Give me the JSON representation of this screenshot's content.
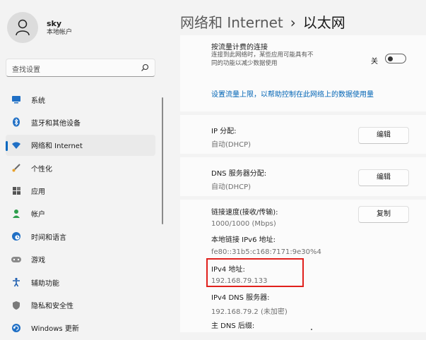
{
  "user": {
    "name": "sky",
    "account_type": "本地帐户"
  },
  "search": {
    "placeholder": "查找设置"
  },
  "sidebar": {
    "items": [
      {
        "label": "系统",
        "icon": "monitor-icon",
        "selected": false
      },
      {
        "label": "蓝牙和其他设备",
        "icon": "bluetooth-icon",
        "selected": false
      },
      {
        "label": "网络和 Internet",
        "icon": "wifi-icon",
        "selected": true
      },
      {
        "label": "个性化",
        "icon": "brush-icon",
        "selected": false
      },
      {
        "label": "应用",
        "icon": "apps-icon",
        "selected": false
      },
      {
        "label": "帐户",
        "icon": "person-icon",
        "selected": false
      },
      {
        "label": "时间和语言",
        "icon": "globe-clock-icon",
        "selected": false
      },
      {
        "label": "游戏",
        "icon": "gamepad-icon",
        "selected": false
      },
      {
        "label": "辅助功能",
        "icon": "accessibility-icon",
        "selected": false
      },
      {
        "label": "隐私和安全性",
        "icon": "shield-icon",
        "selected": false
      },
      {
        "label": "Windows 更新",
        "icon": "update-icon",
        "selected": false
      }
    ]
  },
  "header": {
    "parent": "网络和 Internet",
    "separator": "›",
    "current": "以太网"
  },
  "metered": {
    "title": "按流量计费的连接",
    "description": "连接到此网络时，某些应用可能具有不同的功能以减少数据使用",
    "toggle_label": "关",
    "toggle_on": false,
    "link": "设置流量上限，以帮助控制在此网络上的数据使用量"
  },
  "ip_assignment": {
    "label": "IP 分配:",
    "value": "自动(DHCP)",
    "button": "编辑"
  },
  "dns_assignment": {
    "label": "DNS 服务器分配:",
    "value": "自动(DHCP)",
    "button": "编辑"
  },
  "properties": {
    "copy_button": "复制",
    "rows": [
      {
        "label": "链接速度(接收/传输):",
        "value": "1000/1000 (Mbps)"
      },
      {
        "label": "本地链接 IPv6 地址:",
        "value": "fe80::31b5:c168:7171:9e30%4"
      },
      {
        "label": "IPv4 地址:",
        "value": "192.168.79.133"
      },
      {
        "label": "IPv4 DNS 服务器:",
        "value": "192.168.79.2 (未加密)"
      },
      {
        "label": "主 DNS 后缀:",
        "value": ""
      }
    ]
  },
  "colors": {
    "accent": "#0067c0",
    "link": "#0064b5",
    "highlight": "#e0201c",
    "background": "#f3f3f3",
    "card": "#fbfbfb"
  }
}
